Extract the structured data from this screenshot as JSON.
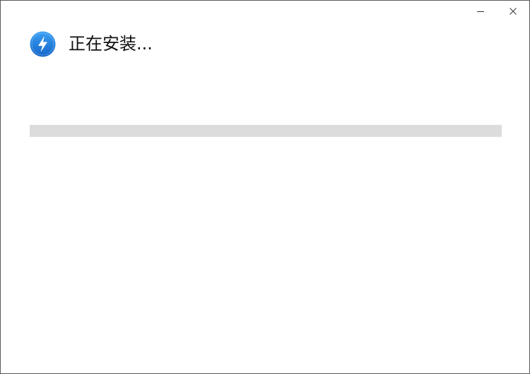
{
  "window": {
    "controls": {
      "minimize_icon": "minimize-icon",
      "close_icon": "close-icon"
    }
  },
  "header": {
    "icon": "lightning-bolt-icon",
    "title": "正在安装..."
  },
  "progress": {
    "percent": 0,
    "track_color": "#dcdcdc",
    "fill_color": "#0a84e6"
  },
  "colors": {
    "icon_blue": "#1a7fe0",
    "icon_blue_light": "#3aa0f5"
  }
}
